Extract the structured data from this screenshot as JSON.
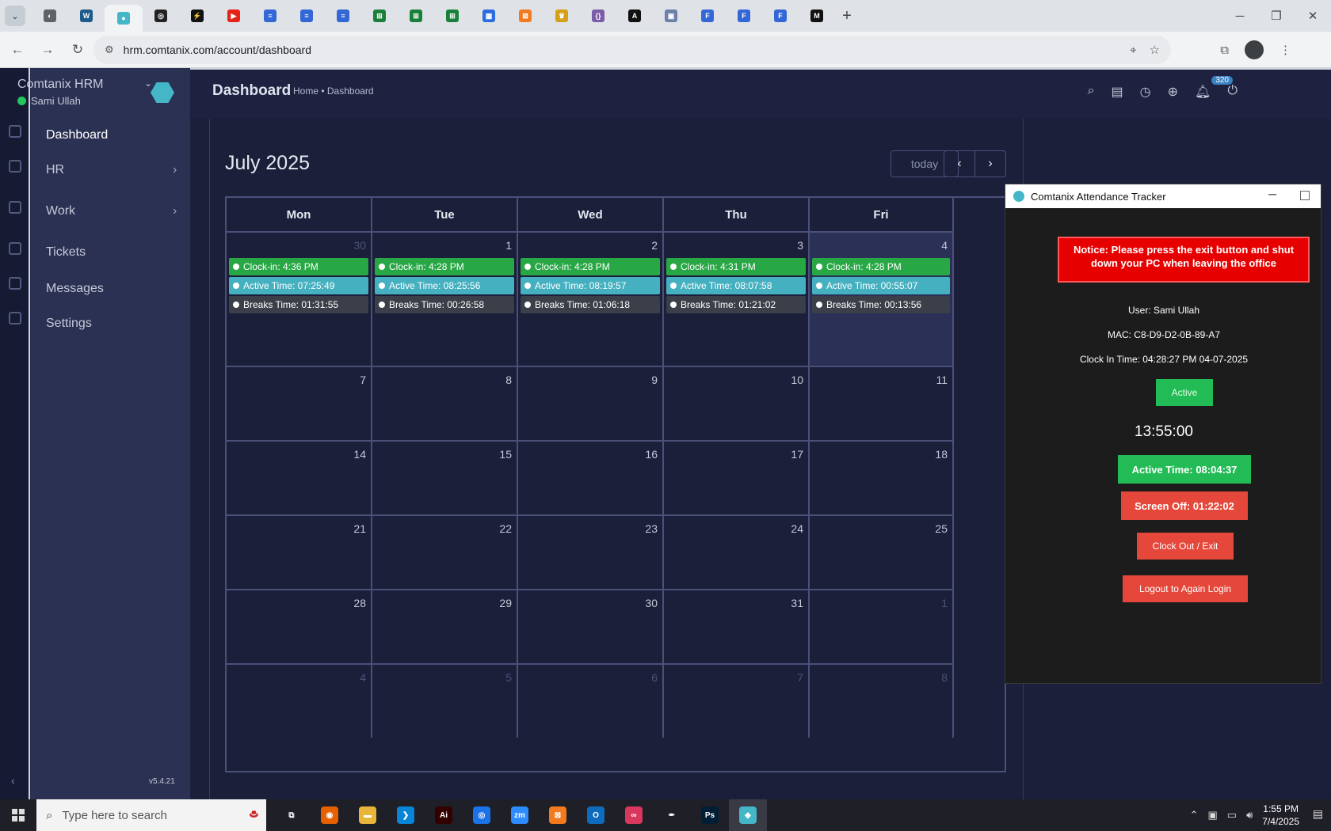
{
  "browser": {
    "url": "hrm.comtanix.com/account/dashboard",
    "tab_icons": [
      {
        "name": "lens-tab-icon",
        "color": "#5f6368",
        "glyph": "◐"
      },
      {
        "name": "wordpress-tab-icon",
        "color": "#1e5b8a",
        "glyph": "W"
      },
      {
        "name": "comtanix-tab-icon",
        "color": "#45b6c8",
        "glyph": "●"
      },
      {
        "name": "openai-tab-icon",
        "color": "#222222",
        "glyph": "◎"
      },
      {
        "name": "bolt-tab-icon",
        "color": "#111111",
        "glyph": "⚡"
      },
      {
        "name": "youtube-tab-icon",
        "color": "#e62117",
        "glyph": "▶"
      },
      {
        "name": "docs-tab-icon",
        "color": "#3367d6",
        "glyph": "≡"
      },
      {
        "name": "docs-tab-icon-2",
        "color": "#3367d6",
        "glyph": "≡"
      },
      {
        "name": "docs-tab-icon-3",
        "color": "#3367d6",
        "glyph": "≡"
      },
      {
        "name": "sheets-tab-icon",
        "color": "#188038",
        "glyph": "⊞"
      },
      {
        "name": "sheets-tab-icon-2",
        "color": "#188038",
        "glyph": "⊞"
      },
      {
        "name": "sheets-tab-icon-3",
        "color": "#188038",
        "glyph": "⊞"
      },
      {
        "name": "grid-tab-icon",
        "color": "#2d6cdf",
        "glyph": "▦"
      },
      {
        "name": "xampp-tab-icon",
        "color": "#f27b1f",
        "glyph": "⊠"
      },
      {
        "name": "crown-tab-icon",
        "color": "#d4a017",
        "glyph": "♛"
      },
      {
        "name": "code-tab-icon",
        "color": "#7b5ca8",
        "glyph": "{}"
      },
      {
        "name": "a-tab-icon",
        "color": "#111111",
        "glyph": "A"
      },
      {
        "name": "image-tab-icon",
        "color": "#6c7fa8",
        "glyph": "▣"
      },
      {
        "name": "forms-tab-icon",
        "color": "#3367d6",
        "glyph": "F"
      },
      {
        "name": "forms-tab-icon-2",
        "color": "#3367d6",
        "glyph": "F"
      },
      {
        "name": "forms-tab-icon-3",
        "color": "#3367d6",
        "glyph": "F"
      },
      {
        "name": "m-tab-icon",
        "color": "#111111",
        "glyph": "M"
      }
    ]
  },
  "sidebar": {
    "brand": "Comtanix HRM",
    "user": "Sami Ullah",
    "version": "v5.4.21",
    "items": [
      {
        "label": "Dashboard",
        "active": true
      },
      {
        "label": "HR",
        "chevron": true
      },
      {
        "label": "Work",
        "chevron": true
      },
      {
        "label": "Tickets"
      },
      {
        "label": "Messages"
      },
      {
        "label": "Settings"
      }
    ]
  },
  "header": {
    "title": "Dashboard",
    "breadcrumb": "Home • Dashboard",
    "badge": "320"
  },
  "calendar": {
    "title": "July 2025",
    "today_label": "today",
    "weekdays": [
      "Mon",
      "Tue",
      "Wed",
      "Thu",
      "Fri"
    ],
    "weeks": [
      [
        {
          "d": "30",
          "muted": true
        },
        {
          "d": "1"
        },
        {
          "d": "2"
        },
        {
          "d": "3"
        },
        {
          "d": "4",
          "today": true
        }
      ],
      [
        {
          "d": "7"
        },
        {
          "d": "8"
        },
        {
          "d": "9"
        },
        {
          "d": "10"
        },
        {
          "d": "11"
        }
      ],
      [
        {
          "d": "14"
        },
        {
          "d": "15"
        },
        {
          "d": "16"
        },
        {
          "d": "17"
        },
        {
          "d": "18"
        }
      ],
      [
        {
          "d": "21"
        },
        {
          "d": "22"
        },
        {
          "d": "23"
        },
        {
          "d": "24"
        },
        {
          "d": "25"
        }
      ],
      [
        {
          "d": "28"
        },
        {
          "d": "29"
        },
        {
          "d": "30"
        },
        {
          "d": "31"
        },
        {
          "d": "1",
          "muted": true
        }
      ],
      [
        {
          "d": "4",
          "muted": true
        },
        {
          "d": "5",
          "muted": true
        },
        {
          "d": "6",
          "muted": true
        },
        {
          "d": "7",
          "muted": true
        },
        {
          "d": "8",
          "muted": true
        }
      ]
    ],
    "events": [
      {
        "clock": "Clock-in: 4:36 PM",
        "active": "Active Time: 07:25:49",
        "breaks": "Breaks Time: 01:31:55"
      },
      {
        "clock": "Clock-in: 4:28 PM",
        "active": "Active Time: 08:25:56",
        "breaks": "Breaks Time: 00:26:58"
      },
      {
        "clock": "Clock-in: 4:28 PM",
        "active": "Active Time: 08:19:57",
        "breaks": "Breaks Time: 01:06:18"
      },
      {
        "clock": "Clock-in: 4:31 PM",
        "active": "Active Time: 08:07:58",
        "breaks": "Breaks Time: 01:21:02"
      },
      {
        "clock": "Clock-in: 4:28 PM",
        "active": "Active Time: 00:55:07",
        "breaks": "Breaks Time: 00:13:56"
      }
    ]
  },
  "tracker": {
    "title": "Comtanix Attendance Tracker",
    "notice": "Notice: Please press the exit button and shut down your PC when leaving the office",
    "user": "User: Sami Ullah",
    "mac": "MAC: C8-D9-D2-0B-89-A7",
    "clock_in": "Clock In Time: 04:28:27 PM 04-07-2025",
    "status": "Active",
    "timer": "13:55:00",
    "active_time": "Active Time: 08:04:37",
    "screen_off": "Screen Off: 01:22:02",
    "clock_out": "Clock Out / Exit",
    "logout": "Logout to Again Login"
  },
  "taskbar": {
    "search_placeholder": "Type here to search",
    "time": "1:55 PM",
    "date": "7/4/2025",
    "apps": [
      {
        "name": "task-view-icon",
        "color": "#1f1f27",
        "glyph": "⧉"
      },
      {
        "name": "firefox-icon",
        "color": "#e66000",
        "glyph": "◉"
      },
      {
        "name": "file-explorer-icon",
        "color": "#e8b53a",
        "glyph": "▬"
      },
      {
        "name": "vscode-icon",
        "color": "#0a84d8",
        "glyph": "❯"
      },
      {
        "name": "illustrator-icon",
        "color": "#330000",
        "glyph": "Ai"
      },
      {
        "name": "chrome-icon",
        "color": "#1a73e8",
        "glyph": "◎"
      },
      {
        "name": "zoom-icon",
        "color": "#2d8cff",
        "glyph": "zm"
      },
      {
        "name": "xampp-icon",
        "color": "#f27b1f",
        "glyph": "⊠"
      },
      {
        "name": "outlook-icon",
        "color": "#0f6cbd",
        "glyph": "O"
      },
      {
        "name": "creative-cloud-icon",
        "color": "#d9385e",
        "glyph": "∞"
      },
      {
        "name": "pen-tool-icon",
        "color": "#1f1f27",
        "glyph": "✒"
      },
      {
        "name": "photoshop-icon",
        "color": "#001e36",
        "glyph": "Ps"
      },
      {
        "name": "comtanix-app-icon",
        "color": "#45b6c8",
        "glyph": "◆"
      }
    ]
  }
}
